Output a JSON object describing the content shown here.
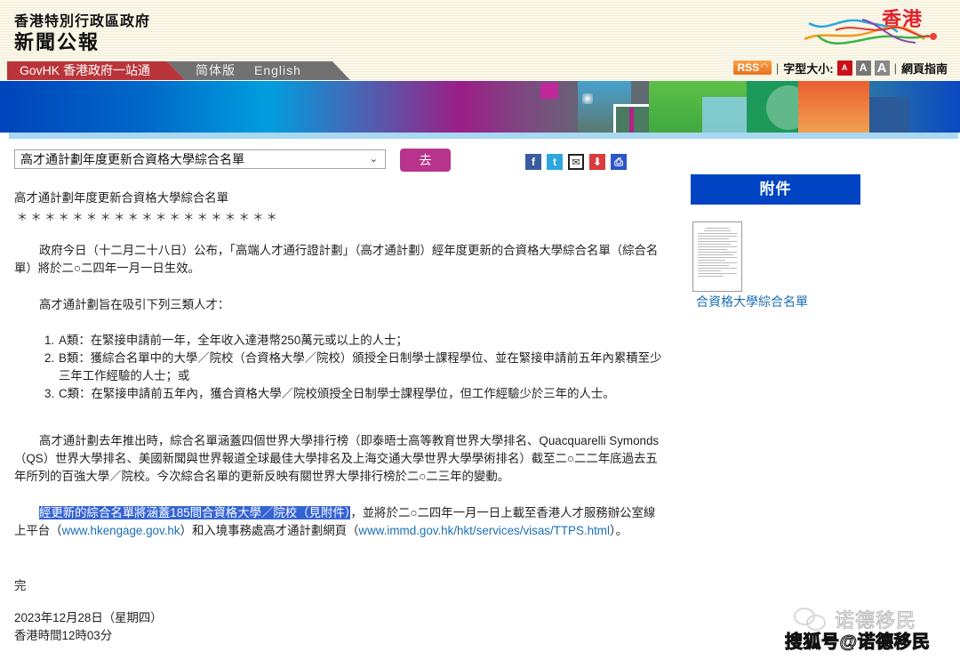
{
  "header": {
    "gov_name": "香港特別行政區政府",
    "press_title": "新聞公報",
    "nav": {
      "govhk": "GovHK 香港政府一站通",
      "simplified": "简体版",
      "english": "English"
    },
    "logo_text": "香港",
    "tools": {
      "rss": "RSS",
      "font_size_label": "字型大小:",
      "font_sizes": [
        "A",
        "A",
        "A"
      ],
      "guide": "網頁指南"
    }
  },
  "controls": {
    "topic_select_value": "高才通計劃年度更新合資格大學綜合名單",
    "go_button": "去",
    "share_icons": [
      "facebook",
      "twitter",
      "email",
      "download",
      "print"
    ]
  },
  "article": {
    "title": "高才通計劃年度更新合資格大學綜合名單",
    "stars": "＊＊＊＊＊＊＊＊＊＊＊＊＊＊＊＊＊＊＊",
    "para1": "政府今日（十二月二十八日）公布，「高端人才通行證計劃」（高才通計劃）經年度更新的合資格大學綜合名單（綜合名單）將於二○二四年一月一日生效。",
    "para2": "高才通計劃旨在吸引下列三類人才：",
    "list": [
      {
        "num": "1.",
        "text": "A類：在緊接申請前一年，全年收入達港幣250萬元或以上的人士；"
      },
      {
        "num": "2.",
        "text": "B類：獲綜合名單中的大學／院校（合資格大學／院校）頒授全日制學士課程學位、並在緊接申請前五年內累積至少三年工作經驗的人士；或"
      },
      {
        "num": "3.",
        "text": "C類：在緊接申請前五年內，獲合資格大學／院校頒授全日制學士課程學位，但工作經驗少於三年的人士。"
      }
    ],
    "para3": "高才通計劃去年推出時，綜合名單涵蓋四個世界大學排行榜（即泰晤士高等教育世界大學排名、Quacquarelli Symonds（QS）世界大學排名、美國新聞與世界報道全球最佳大學排名及上海交通大學世界大學學術排名）截至二○二二年底過去五年所列的百強大學／院校。今次綜合名單的更新反映有關世界大學排行榜於二○二三年的變動。",
    "para4": {
      "highlighted": "經更新的綜合名單將涵蓋185間合資格大學／院校（見附件）",
      "text1": "，並將於二○二四年一月一日上載至香港人才服務辦公室線上平台（",
      "link1": "www.hkengage.gov.hk",
      "text2": "）和入境事務處高才通計劃網頁（",
      "link2": "www.immd.gov.hk/hkt/services/visas/TTPS.html",
      "text3": "）。"
    },
    "end": "完",
    "date": "2023年12月28日（星期四）",
    "time": "香港時間12時03分"
  },
  "sidebar": {
    "attachment_heading": "附件",
    "attachment_link": "合資格大學綜合名單"
  },
  "watermark": {
    "name": "诺德移民",
    "source": "搜狐号@诺德移民"
  }
}
